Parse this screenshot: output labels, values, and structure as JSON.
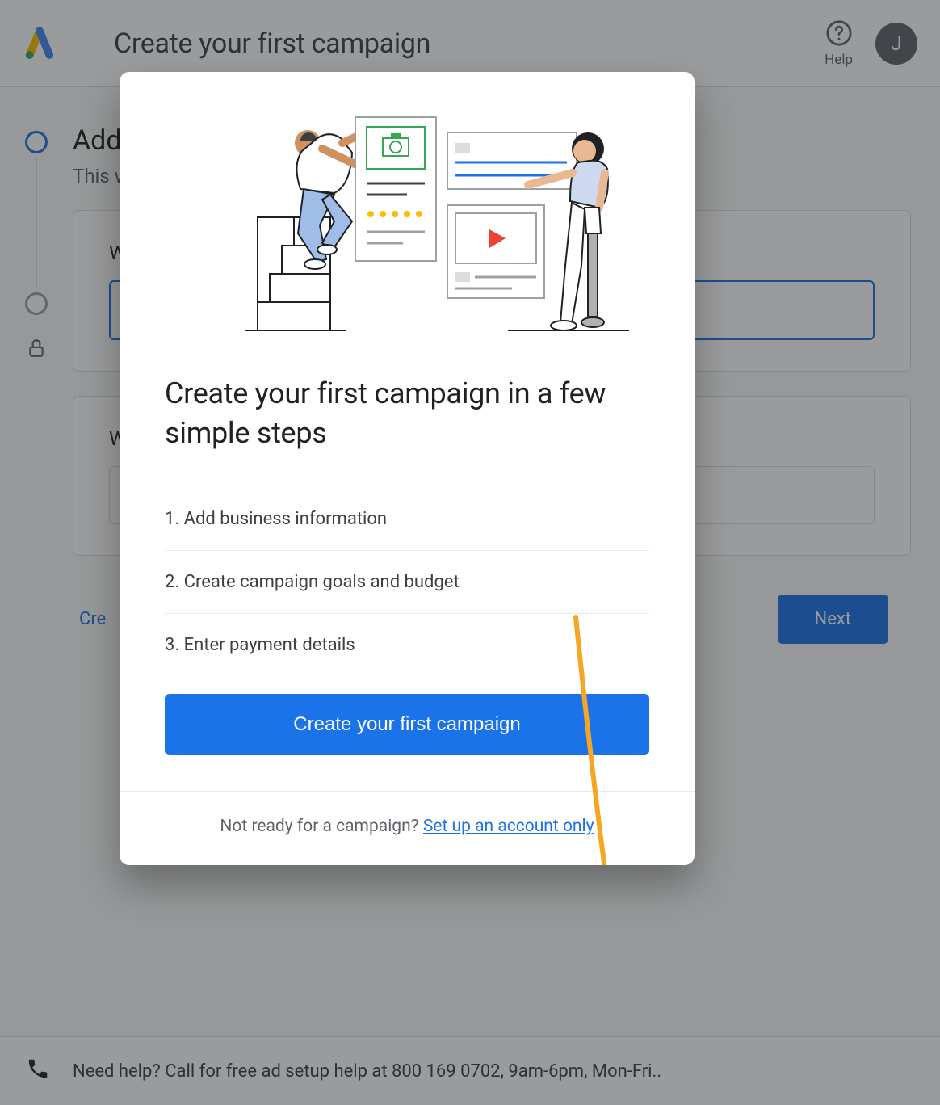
{
  "header": {
    "title": "Create your first campaign",
    "help_label": "Help",
    "avatar_initial": "J"
  },
  "page": {
    "title": "Add business info",
    "subtitle": "This will help set up",
    "card1_label": "W",
    "card2_label": "W",
    "create_account_link": "Cre",
    "next_button": "Next"
  },
  "help_bar": {
    "text": "Need help? Call for free ad setup help at 800 169 0702, 9am-6pm, Mon-Fri.."
  },
  "modal": {
    "title": "Create your first campaign in a few simple steps",
    "steps": [
      "1. Add business information",
      "2. Create campaign goals and budget",
      "3. Enter payment details"
    ],
    "primary_button": "Create your first campaign",
    "footer_question": "Not ready for a campaign? ",
    "footer_link": "Set up an account only"
  },
  "colors": {
    "primary": "#1a73e8",
    "arrow": "#f5a623"
  }
}
